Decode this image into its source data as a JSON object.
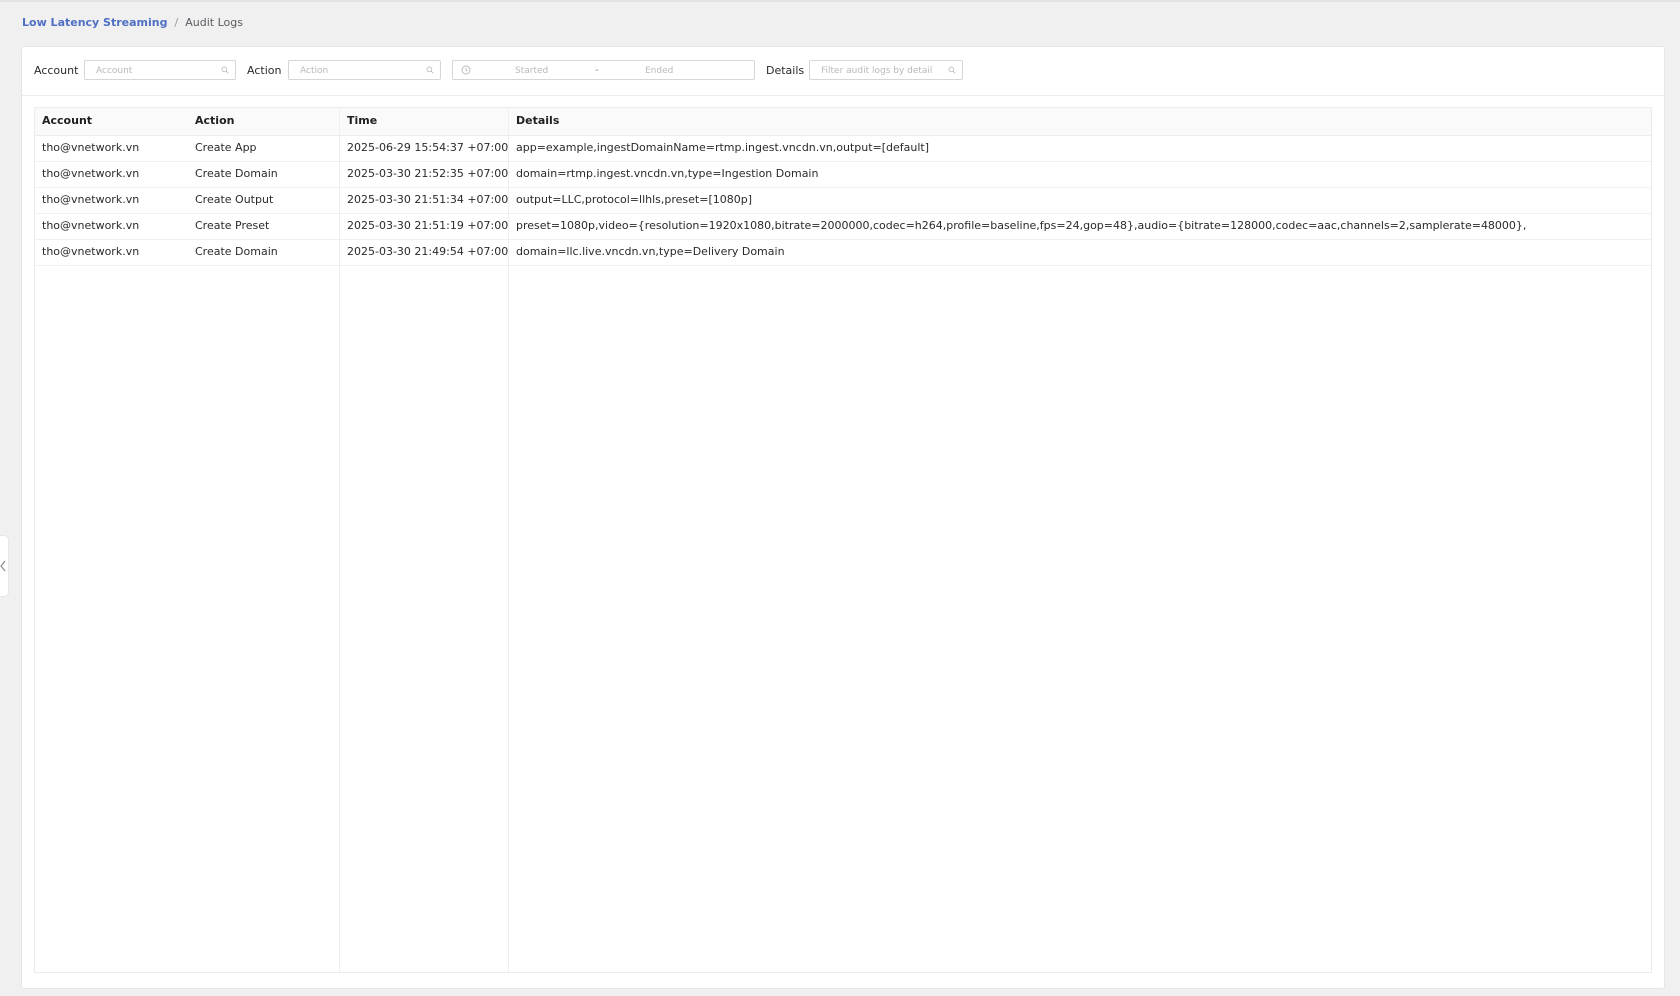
{
  "breadcrumb": {
    "parent": "Low Latency Streaming",
    "separator": "/",
    "current": "Audit Logs"
  },
  "filters": {
    "account_label": "Account",
    "account_placeholder": "Account",
    "action_label": "Action",
    "action_placeholder": "Action",
    "date_started_placeholder": "Started",
    "date_separator": "-",
    "date_ended_placeholder": "Ended",
    "details_label": "Details",
    "details_placeholder": "Filter audit logs by detail"
  },
  "table": {
    "columns": [
      "Account",
      "Action",
      "Time",
      "Details"
    ],
    "rows": [
      {
        "account": "tho@vnetwork.vn",
        "action": "Create App",
        "time": "2025-06-29 15:54:37 +07:00",
        "details": "app=example,ingestDomainName=rtmp.ingest.vncdn.vn,output=[default]"
      },
      {
        "account": "tho@vnetwork.vn",
        "action": "Create Domain",
        "time": "2025-03-30 21:52:35 +07:00",
        "details": "domain=rtmp.ingest.vncdn.vn,type=Ingestion Domain"
      },
      {
        "account": "tho@vnetwork.vn",
        "action": "Create Output",
        "time": "2025-03-30 21:51:34 +07:00",
        "details": "output=LLC,protocol=llhls,preset=[1080p]"
      },
      {
        "account": "tho@vnetwork.vn",
        "action": "Create Preset",
        "time": "2025-03-30 21:51:19 +07:00",
        "details": "preset=1080p,video={resolution=1920x1080,bitrate=2000000,codec=h264,profile=baseline,fps=24,gop=48},audio={bitrate=128000,codec=aac,channels=2,samplerate=48000},"
      },
      {
        "account": "tho@vnetwork.vn",
        "action": "Create Domain",
        "time": "2025-03-30 21:49:54 +07:00",
        "details": "domain=llc.live.vncdn.vn,type=Delivery Domain"
      }
    ]
  },
  "colors": {
    "accent": "#4f6fc2",
    "background": "#f0f0f1",
    "card": "#ffffff",
    "border": "#d6d6da"
  },
  "icons": {
    "search": "search-icon",
    "clock": "clock-icon",
    "collapse": "chevron-left-icon"
  }
}
